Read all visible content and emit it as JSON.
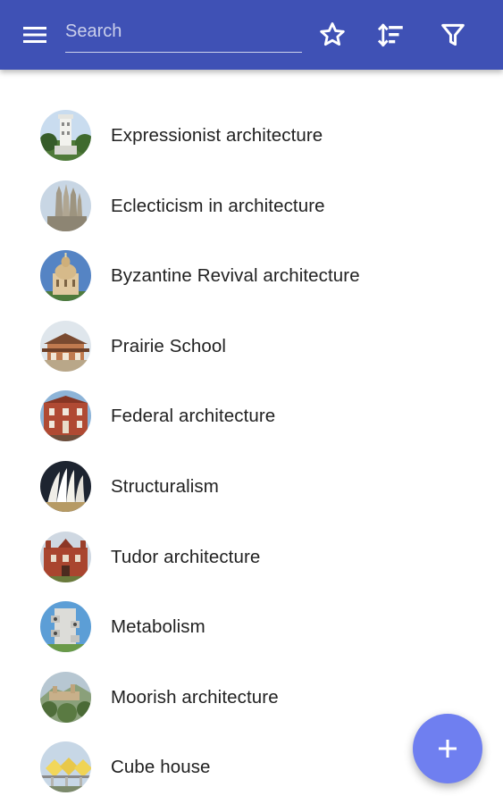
{
  "toolbar": {
    "background": "#3f51b5",
    "menu_icon": "menu-icon",
    "search_placeholder": "Search",
    "search_value": "",
    "actions": [
      "star-icon",
      "sort-icon",
      "filter-icon"
    ]
  },
  "list": {
    "items": [
      {
        "label": "Expressionist architecture",
        "thumbnail": "expressionist-architecture-photo"
      },
      {
        "label": "Eclecticism in architecture",
        "thumbnail": "eclecticism-architecture-photo"
      },
      {
        "label": "Byzantine Revival architecture",
        "thumbnail": "byzantine-revival-photo"
      },
      {
        "label": "Prairie School",
        "thumbnail": "prairie-school-photo"
      },
      {
        "label": "Federal architecture",
        "thumbnail": "federal-architecture-photo"
      },
      {
        "label": "Structuralism",
        "thumbnail": "structuralism-photo"
      },
      {
        "label": "Tudor architecture",
        "thumbnail": "tudor-architecture-photo"
      },
      {
        "label": "Metabolism",
        "thumbnail": "metabolism-photo"
      },
      {
        "label": "Moorish architecture",
        "thumbnail": "moorish-architecture-photo"
      },
      {
        "label": "Cube house",
        "thumbnail": "cube-house-photo"
      }
    ]
  },
  "fab": {
    "icon": "plus-icon",
    "color": "#6f7ff0"
  }
}
